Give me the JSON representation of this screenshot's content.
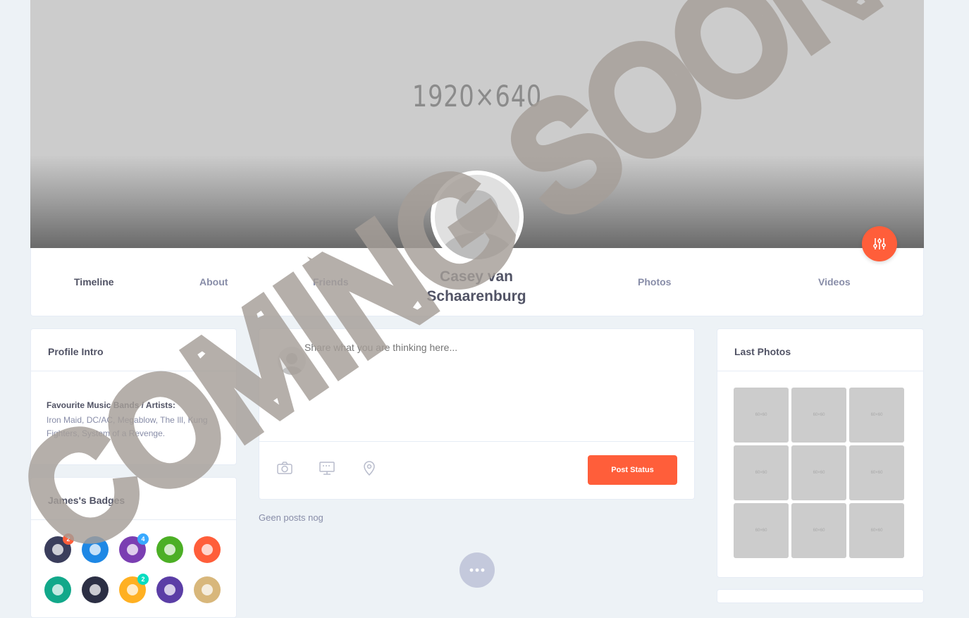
{
  "cover": {
    "label": "1920×640"
  },
  "nav": {
    "timeline": "Timeline",
    "about": "About",
    "friends": "Friends",
    "photos": "Photos",
    "videos": "Videos"
  },
  "profile": {
    "name": "Casey van Schaarenburg"
  },
  "intro": {
    "title": "Profile Intro",
    "field_label": "Favourite Music Bands / Artists:",
    "field_value": "Iron Maid, DC/AC, Megablow, The Ill, Kung Fighters, System of a Revenge."
  },
  "badges": {
    "title": "James's Badges",
    "items": [
      {
        "icon": "lightning-badge-icon",
        "color": "#3b3e5c",
        "count": "2",
        "count_color": "#ff5e3a"
      },
      {
        "icon": "camera-badge-icon",
        "color": "#1e88e5",
        "count": "",
        "count_color": ""
      },
      {
        "icon": "smiley-badge-icon",
        "color": "#7b3fb2",
        "count": "4",
        "count_color": "#38a9ff"
      },
      {
        "icon": "pencil-badge-icon",
        "color": "#4caf25",
        "count": "",
        "count_color": ""
      },
      {
        "icon": "face-badge-icon",
        "color": "#ff5e3a",
        "count": "",
        "count_color": ""
      },
      {
        "icon": "document-badge-icon",
        "color": "#12a88a",
        "count": "",
        "count_color": ""
      },
      {
        "icon": "vinyl-badge-icon",
        "color": "#2c2f44",
        "count": "",
        "count_color": ""
      },
      {
        "icon": "calendar-badge-icon",
        "color": "#ffb022",
        "count": "2",
        "count_color": "#08ddc1"
      },
      {
        "icon": "rocket-badge-icon",
        "color": "#5b3ea6",
        "count": "",
        "count_color": ""
      },
      {
        "icon": "coffee-badge-icon",
        "color": "#d8b77b",
        "count": "",
        "count_color": ""
      }
    ]
  },
  "post": {
    "placeholder": "Share what you are thinking here...",
    "submit_label": "Post Status",
    "empty_text": "Geen posts nog"
  },
  "photos": {
    "title": "Last Photos",
    "thumb_label": "60×60",
    "count": 9
  },
  "watermark": {
    "text": "COMING SOON"
  },
  "colors": {
    "accent": "#ff5e3a",
    "background": "#edf2f6",
    "text_dark": "#515365",
    "text_muted": "#888da8"
  }
}
